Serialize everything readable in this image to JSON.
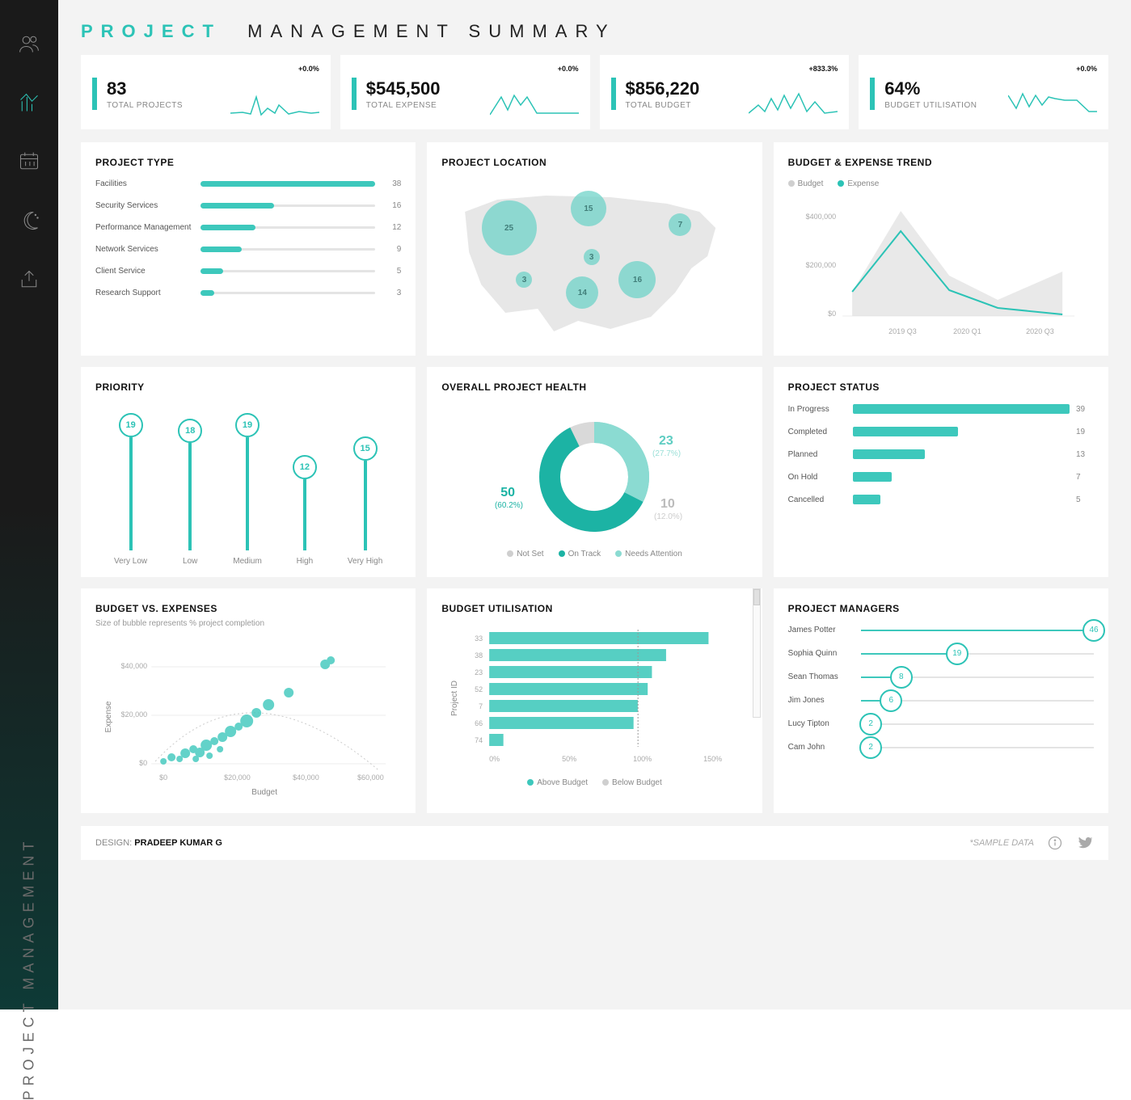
{
  "colors": {
    "accent": "#2cc3b6",
    "accent_light": "#8bdbd2",
    "text": "#111",
    "muted": "#888"
  },
  "sidebar": {
    "vertical_label": "PROJECT  MANAGEMENT"
  },
  "title": {
    "highlight": "PROJECT",
    "rest": "MANAGEMENT  SUMMARY"
  },
  "kpis": [
    {
      "value": "83",
      "label": "TOTAL PROJECTS",
      "pct": "+0.0%"
    },
    {
      "value": "$545,500",
      "label": "TOTAL EXPENSE",
      "pct": "+0.0%"
    },
    {
      "value": "$856,220",
      "label": "TOTAL BUDGET",
      "pct": "+833.3%"
    },
    {
      "value": "64%",
      "label": "BUDGET UTILISATION",
      "pct": "+0.0%"
    }
  ],
  "project_type": {
    "title": "PROJECT TYPE",
    "items": [
      {
        "name": "Facilities",
        "value": 38
      },
      {
        "name": "Security Services",
        "value": 16
      },
      {
        "name": "Performance Management",
        "value": 12
      },
      {
        "name": "Network Services",
        "value": 9
      },
      {
        "name": "Client Service",
        "value": 5
      },
      {
        "name": "Research Support",
        "value": 3
      }
    ]
  },
  "project_location": {
    "title": "PROJECT LOCATION",
    "bubbles": [
      {
        "value": 25,
        "x": 22,
        "y": 30,
        "r": 34
      },
      {
        "value": 15,
        "x": 48,
        "y": 18,
        "r": 22
      },
      {
        "value": 7,
        "x": 78,
        "y": 28,
        "r": 14
      },
      {
        "value": 3,
        "x": 49,
        "y": 48,
        "r": 10
      },
      {
        "value": 3,
        "x": 27,
        "y": 62,
        "r": 10
      },
      {
        "value": 14,
        "x": 46,
        "y": 70,
        "r": 20
      },
      {
        "value": 16,
        "x": 64,
        "y": 62,
        "r": 23
      }
    ]
  },
  "budget_trend": {
    "title": "BUDGET & EXPENSE TREND",
    "legend": [
      {
        "name": "Budget",
        "color": "#cfcfcf"
      },
      {
        "name": "Expense",
        "color": "#2cc3b6"
      }
    ],
    "x": [
      "2019 Q3",
      "2020 Q1",
      "2020 Q3"
    ],
    "y_ticks": [
      "$0",
      "$200,000",
      "$400,000"
    ]
  },
  "priority": {
    "title": "PRIORITY",
    "items": [
      {
        "label": "Very Low",
        "value": 19
      },
      {
        "label": "Low",
        "value": 18
      },
      {
        "label": "Medium",
        "value": 19
      },
      {
        "label": "High",
        "value": 12
      },
      {
        "label": "Very High",
        "value": 15
      }
    ]
  },
  "health": {
    "title": "OVERALL PROJECT HEALTH",
    "segments": [
      {
        "label": "On Track",
        "value": 50,
        "pct": "60.2%",
        "color": "#1cb3a4"
      },
      {
        "label": "Needs Attention",
        "value": 23,
        "pct": "27.7%",
        "color": "#8bdbd2"
      },
      {
        "label": "Not Set",
        "value": 10,
        "pct": "12.0%",
        "color": "#d9d9d9"
      }
    ],
    "legend": [
      "Not Set",
      "On Track",
      "Needs Attention"
    ]
  },
  "status": {
    "title": "PROJECT STATUS",
    "items": [
      {
        "name": "In Progress",
        "value": 39
      },
      {
        "name": "Completed",
        "value": 19
      },
      {
        "name": "Planned",
        "value": 13
      },
      {
        "name": "On Hold",
        "value": 7
      },
      {
        "name": "Cancelled",
        "value": 5
      }
    ]
  },
  "bve": {
    "title": "BUDGET VS. EXPENSES",
    "subtitle": "Size of bubble represents % project completion",
    "xlabel": "Budget",
    "ylabel": "Expense",
    "xticks": [
      "$0",
      "$20,000",
      "$40,000",
      "$60,000"
    ],
    "yticks": [
      "$0",
      "$20,000",
      "$40,000"
    ]
  },
  "util": {
    "title": "BUDGET UTILISATION",
    "ylabel": "Project ID",
    "ids": [
      "33",
      "38",
      "23",
      "52",
      "7",
      "66",
      "74"
    ],
    "values": [
      155,
      125,
      115,
      112,
      105,
      102,
      10
    ],
    "xticks": [
      "0%",
      "50%",
      "100%",
      "150%"
    ],
    "legend": [
      "Above Budget",
      "Below Budget"
    ]
  },
  "managers": {
    "title": "PROJECT MANAGERS",
    "items": [
      {
        "name": "James Potter",
        "value": 46
      },
      {
        "name": "Sophia Quinn",
        "value": 19
      },
      {
        "name": "Sean Thomas",
        "value": 8
      },
      {
        "name": "Jim Jones",
        "value": 6
      },
      {
        "name": "Lucy Tipton",
        "value": 2
      },
      {
        "name": "Cam John",
        "value": 2
      }
    ]
  },
  "footer": {
    "design_prefix": "DESIGN: ",
    "design_name": "PRADEEP KUMAR G",
    "sample": "*SAMPLE DATA"
  },
  "chart_data": [
    {
      "type": "bar",
      "title": "PROJECT TYPE",
      "categories": [
        "Facilities",
        "Security Services",
        "Performance Management",
        "Network Services",
        "Client Service",
        "Research Support"
      ],
      "values": [
        38,
        16,
        12,
        9,
        5,
        3
      ]
    },
    {
      "type": "bubble-map",
      "title": "PROJECT LOCATION",
      "points": [
        {
          "label": "25",
          "count": 25
        },
        {
          "label": "15",
          "count": 15
        },
        {
          "label": "7",
          "count": 7
        },
        {
          "label": "3",
          "count": 3
        },
        {
          "label": "3",
          "count": 3
        },
        {
          "label": "14",
          "count": 14
        },
        {
          "label": "16",
          "count": 16
        }
      ]
    },
    {
      "type": "line",
      "title": "BUDGET & EXPENSE TREND",
      "x": [
        "2019 Q3",
        "2020 Q1",
        "2020 Q3"
      ],
      "series": [
        {
          "name": "Budget",
          "values": [
            100000,
            430000,
            180000,
            60000,
            160000
          ]
        },
        {
          "name": "Expense",
          "values": [
            100000,
            330000,
            100000,
            25000,
            10000
          ]
        }
      ],
      "ylabel": "USD",
      "ylim": [
        0,
        450000
      ]
    },
    {
      "type": "bar",
      "title": "PRIORITY",
      "categories": [
        "Very Low",
        "Low",
        "Medium",
        "High",
        "Very High"
      ],
      "values": [
        19,
        18,
        19,
        12,
        15
      ]
    },
    {
      "type": "pie",
      "title": "OVERALL PROJECT HEALTH",
      "categories": [
        "On Track",
        "Needs Attention",
        "Not Set"
      ],
      "values": [
        50,
        23,
        10
      ]
    },
    {
      "type": "bar",
      "title": "PROJECT STATUS",
      "categories": [
        "In Progress",
        "Completed",
        "Planned",
        "On Hold",
        "Cancelled"
      ],
      "values": [
        39,
        19,
        13,
        7,
        5
      ]
    },
    {
      "type": "scatter",
      "title": "BUDGET VS. EXPENSES",
      "xlabel": "Budget",
      "ylabel": "Expense",
      "xlim": [
        0,
        60000
      ],
      "ylim": [
        0,
        50000
      ],
      "note": "bubble size = % completion"
    },
    {
      "type": "bar",
      "title": "BUDGET UTILISATION",
      "categories": [
        "33",
        "38",
        "23",
        "52",
        "7",
        "66",
        "74"
      ],
      "values": [
        155,
        125,
        115,
        112,
        105,
        102,
        10
      ],
      "xlabel": "%",
      "xlim": [
        0,
        160
      ]
    },
    {
      "type": "bar",
      "title": "PROJECT MANAGERS",
      "categories": [
        "James Potter",
        "Sophia Quinn",
        "Sean Thomas",
        "Jim Jones",
        "Lucy Tipton",
        "Cam John"
      ],
      "values": [
        46,
        19,
        8,
        6,
        2,
        2
      ]
    }
  ]
}
